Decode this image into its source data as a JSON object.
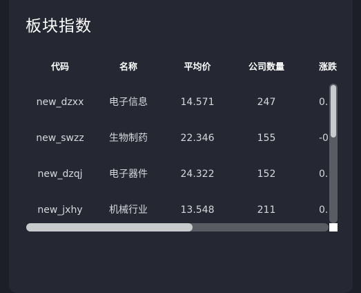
{
  "panel": {
    "title": "板块指数"
  },
  "table": {
    "columns": [
      "代码",
      "名称",
      "平均价",
      "公司数量",
      "涨跌"
    ],
    "rows": [
      [
        "new_dzxx",
        "电子信息",
        "14.571",
        "247",
        "0."
      ],
      [
        "new_swzz",
        "生物制药",
        "22.346",
        "155",
        "-0"
      ],
      [
        "new_dzqj",
        "电子器件",
        "24.322",
        "152",
        "0."
      ],
      [
        "new_jxhy",
        "机械行业",
        "13.548",
        "211",
        "0."
      ]
    ]
  },
  "colors": {
    "background": "#1c1f27",
    "card": "#252833",
    "text": "#d6d8de",
    "scroll_track": "#5a5c63",
    "scroll_thumb": "#c9cacd"
  }
}
